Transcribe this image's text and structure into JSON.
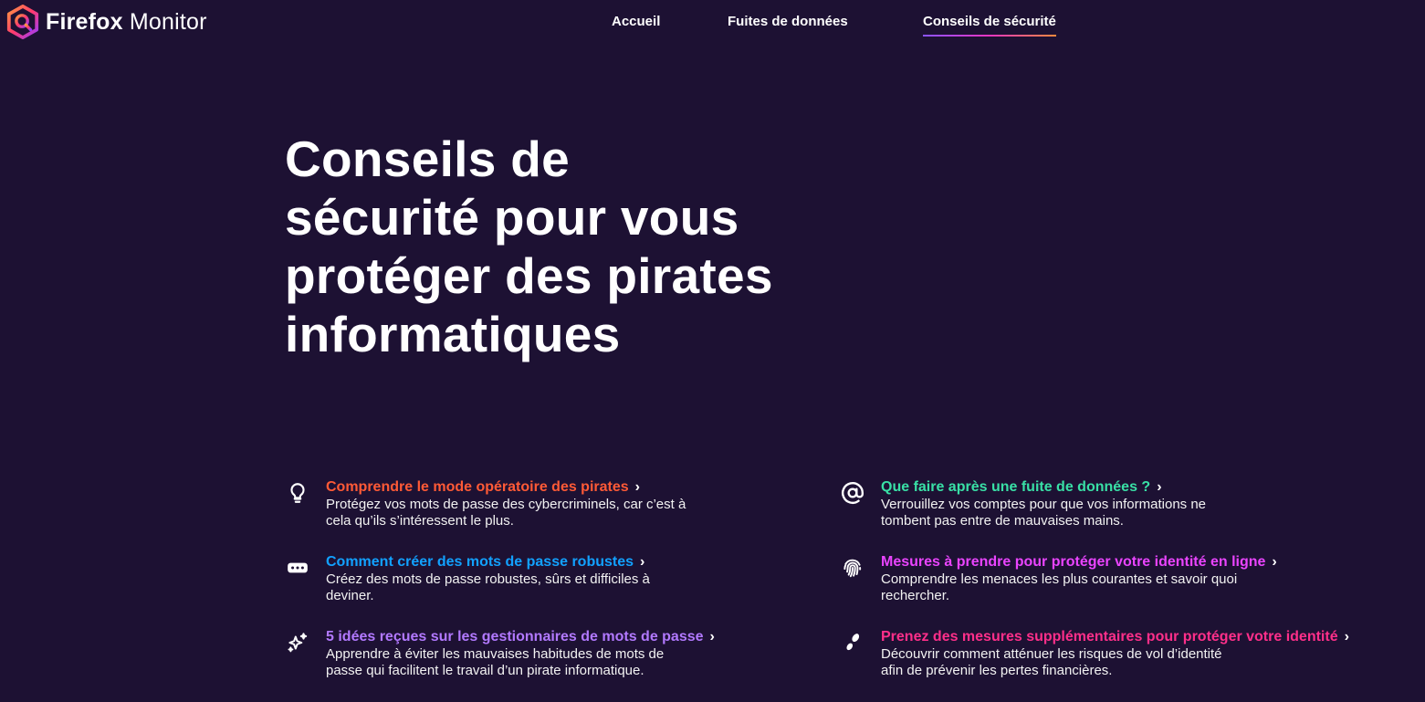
{
  "header": {
    "brand_bold": "Firefox",
    "brand_light": " Monitor",
    "nav": [
      {
        "label": "Accueil"
      },
      {
        "label": "Fuites de données"
      },
      {
        "label": "Conseils de sécurité",
        "active": true
      }
    ]
  },
  "hero": {
    "title": "Conseils de sécurité pour vous protéger des pirates informatiques"
  },
  "tips": [
    {
      "title": "Comprendre le mode opératoire des pirates",
      "description": "Protégez vos mots de passe des cybercriminels, car c’est à cela qu’ils s’intéressent le plus.",
      "icon": "lightbulb-icon",
      "color": "#ff5a36"
    },
    {
      "title": "Que faire après une fuite de données ?",
      "description": "Verrouillez vos comptes pour que vos informations ne tombent pas entre de mauvaises mains.",
      "icon": "at-sign-icon",
      "color": "#39e0a6"
    },
    {
      "title": "Comment créer des mots de passe robustes",
      "description": "Créez des mots de passe robustes, sûrs et difficiles à deviner.",
      "icon": "password-dots-icon",
      "color": "#12a1ff"
    },
    {
      "title": "Mesures à prendre pour protéger votre identité en ligne",
      "description": "Comprendre les menaces les plus courantes et savoir quoi rechercher.",
      "icon": "fingerprint-icon",
      "color": "#ea44ff"
    },
    {
      "title": "5 idées reçues sur les gestionnaires de mots de passe",
      "description": "Apprendre à éviter les mauvaises habitudes de mots de passe qui facilitent le travail d’un pirate informatique.",
      "icon": "sparkles-icon",
      "color": "#b279ff"
    },
    {
      "title": "Prenez des mesures supplémentaires pour protéger votre identité",
      "description": "Découvrir comment atténuer les risques de vol d’identité afin de prévenir les pertes financières.",
      "icon": "footprints-icon",
      "color": "#ff2f8a"
    }
  ],
  "chevron": "›"
}
